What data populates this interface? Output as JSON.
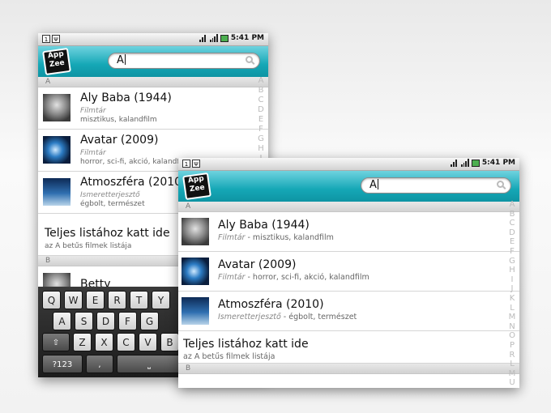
{
  "status": {
    "time": "5:41 PM"
  },
  "logo": {
    "line1": "App",
    "line2": "Zee"
  },
  "search": {
    "value": "A"
  },
  "sections": {
    "a": "A",
    "b": "B"
  },
  "items": [
    {
      "title": "Aly Baba (1944)",
      "category": "Filmtár",
      "tags": "misztikus, kalandfilm",
      "sub2": " - misztikus, kalandfilm"
    },
    {
      "title": "Avatar (2009)",
      "category": "Filmtár",
      "tags": "horror, sci-fi, akció, kalandfilm",
      "tags_cut": "horror, sci-fi, akció, kalandfi",
      "sub2": " - horror, sci-fi, akció, kalandfilm"
    },
    {
      "title": "Atmoszféra (2010)",
      "category": "Ismeretterjesztő",
      "tags": "égbolt, természet",
      "sub2": " - égbolt, természet"
    }
  ],
  "full_list": {
    "title": "Teljes listához katt ide",
    "subtitle": "az A betűs filmek listája"
  },
  "next_item": {
    "title": "Betty"
  },
  "index_letters_1": [
    "A",
    "B",
    "C",
    "D",
    "E",
    "F",
    "G",
    "H",
    "I"
  ],
  "index_letters_2": [
    "A",
    "B",
    "C",
    "D",
    "E",
    "F",
    "G",
    "H",
    "I",
    "J",
    "K",
    "L",
    "M",
    "N",
    "O",
    "P",
    "R",
    "L",
    "M",
    "U",
    "P"
  ],
  "keyboard": {
    "row1": [
      "Q",
      "W",
      "E",
      "R",
      "T",
      "Y"
    ],
    "row2": [
      "A",
      "S",
      "D",
      "F",
      "G"
    ],
    "row3": [
      "Z",
      "X",
      "C",
      "V",
      "B"
    ],
    "shift": "⇧",
    "num": "?123",
    "comma": ",",
    "space": "⎵"
  }
}
